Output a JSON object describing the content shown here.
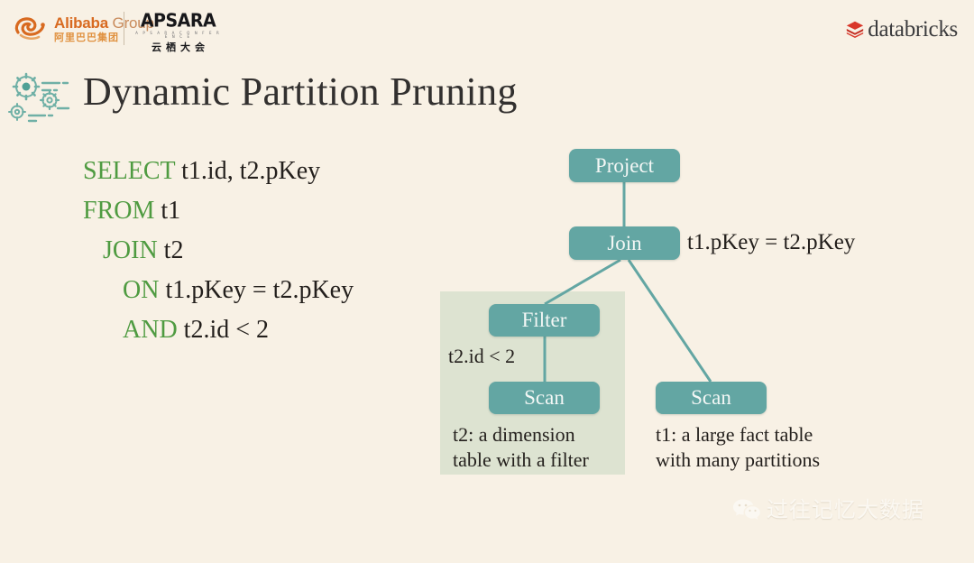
{
  "header": {
    "alibaba": {
      "name_en": "Alibaba",
      "group_word": "Group",
      "name_cn": "阿里巴巴集团",
      "icon": "alibaba-swirl-icon"
    },
    "apsara": {
      "word": "APSARA",
      "subtitle": "A P S A R A   C O N F E R E N C E",
      "cn": "云栖大会"
    },
    "databricks": {
      "word": "databricks",
      "icon": "databricks-stack-icon"
    }
  },
  "title": {
    "text": "Dynamic Partition Pruning",
    "icon": "gears-icon"
  },
  "sql": {
    "lines": [
      {
        "keyword": "SELECT",
        "rest": " t1.id, t2.pKey",
        "indent": 0
      },
      {
        "keyword": "FROM",
        "rest": "  t1",
        "indent": 0
      },
      {
        "keyword": "JOIN",
        "rest": " t2",
        "indent": 1
      },
      {
        "keyword": "ON",
        "rest": " t1.pKey = t2.pKey",
        "indent": 2
      },
      {
        "keyword": "AND",
        "rest": " t2.id < 2",
        "indent": 2
      }
    ]
  },
  "plan": {
    "nodes": {
      "project": "Project",
      "join": "Join",
      "filter": "Filter",
      "scan_t2": "Scan",
      "scan_t1": "Scan"
    },
    "labels": {
      "join_condition": "t1.pKey = t2.pKey",
      "filter_condition": "t2.id < 2"
    },
    "captions": {
      "t2_line1": "t2: a dimension",
      "t2_line2": "table with a filter",
      "t1_line1": "t1: a large fact table",
      "t1_line2": "with many partitions"
    }
  },
  "watermark": {
    "text": "过往记忆大数据",
    "icon": "wechat-icon"
  },
  "colors": {
    "background": "#f8f1e5",
    "node_teal": "#63a6a3",
    "panel_green": "#dde3d1",
    "sql_keyword_green": "#4f9b41",
    "text_dark": "#231f1c",
    "databricks_red": "#d9372a",
    "alibaba_orange": "#d86a20"
  }
}
